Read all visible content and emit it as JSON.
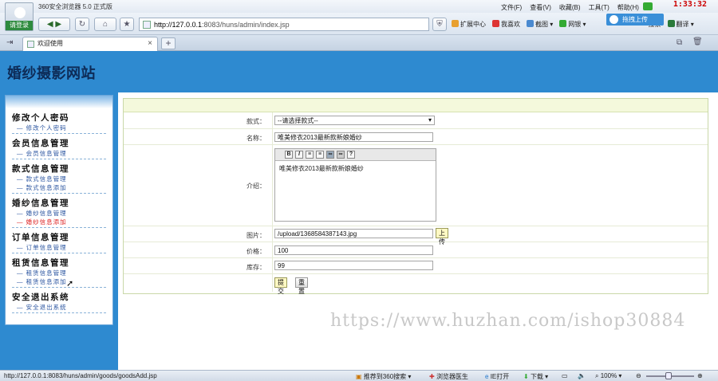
{
  "browser": {
    "title": "360安全浏览器 5.0 正式版",
    "login": "请登录",
    "menu": [
      "文件(F)",
      "查看(V)",
      "收藏(B)",
      "工具(T)",
      "帮助(H)"
    ],
    "clock": "1:33:32",
    "url_host": "http://127.0.0.1",
    "url_rest": ":8083/huns/admin/index.jsp",
    "tools": [
      "扩展中心",
      "我喜欢",
      "截图",
      "网银",
      "搜索",
      "翻译"
    ],
    "float_button": "拖拽上传",
    "tab_title": "欢迎使用",
    "status_url": "http://127.0.0.1:8083/huns/admin/goods/goodsAdd.jsp",
    "status_items": [
      "推荐到360搜索",
      "浏览器医生",
      "IE打开",
      "下载",
      "100%"
    ]
  },
  "site": {
    "title": "婚纱摄影网站"
  },
  "menu": [
    {
      "head": "修改个人密码",
      "items": [
        {
          "label": "— 修改个人密码",
          "active": false
        }
      ]
    },
    {
      "head": "会员信息管理",
      "items": [
        {
          "label": "— 会员信息管理",
          "active": false
        }
      ]
    },
    {
      "head": "款式信息管理",
      "items": [
        {
          "label": "— 款式信息管理",
          "active": false
        },
        {
          "label": "— 款式信息添加",
          "active": false
        }
      ]
    },
    {
      "head": "婚纱信息管理",
      "items": [
        {
          "label": "— 婚纱信息管理",
          "active": false
        },
        {
          "label": "— 婚纱信息添加",
          "active": true
        }
      ]
    },
    {
      "head": "订单信息管理",
      "items": [
        {
          "label": "— 订单信息管理",
          "active": false
        }
      ]
    },
    {
      "head": "租赁信息管理",
      "items": [
        {
          "label": "— 租赁信息管理",
          "active": false
        },
        {
          "label": "— 租赁信息添加",
          "active": false
        }
      ]
    },
    {
      "head": "安全退出系统",
      "items": [
        {
          "label": "— 安全退出系统",
          "active": false
        }
      ]
    }
  ],
  "form": {
    "style_label": "款式：",
    "style_value": "--请选择款式--",
    "name_label": "名称：",
    "name_value": "唯美修衣2013最新款新娘婚纱",
    "intro_label": "介绍：",
    "intro_value": "唯美修衣2013最新款新娘婚纱",
    "image_label": "图片：",
    "image_value": "/upload/1368584387143.jpg",
    "upload_button": "上传",
    "price_label": "价格：",
    "price_value": "100",
    "stock_label": "库存：",
    "stock_value": "99",
    "submit_button": "提交",
    "reset_button": "重置"
  },
  "watermark": "https://www.huzhan.com/ishop30884"
}
